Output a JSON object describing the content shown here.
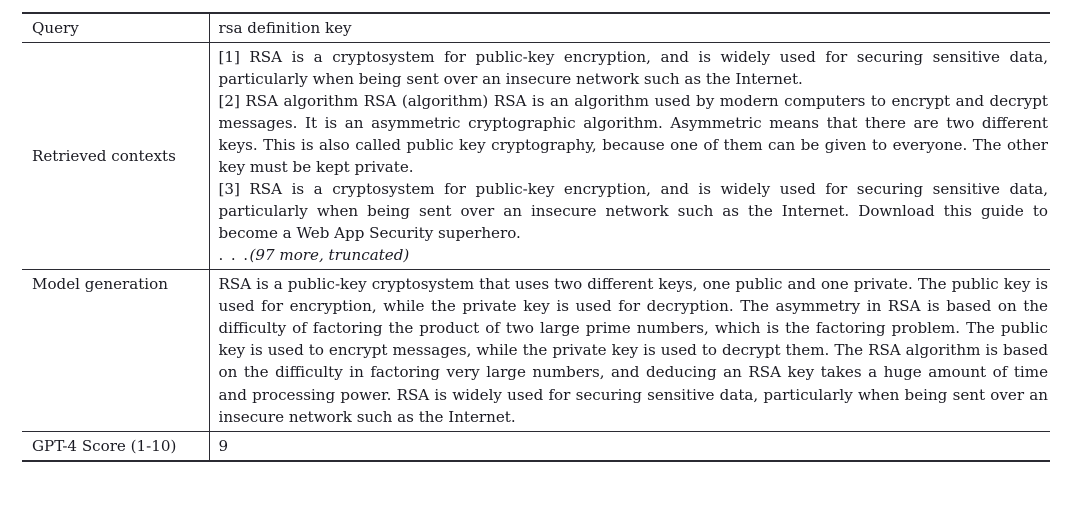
{
  "table": {
    "rows": [
      {
        "label": "Query",
        "type": "query",
        "value": "rsa definition key"
      },
      {
        "label": "Retrieved contexts",
        "type": "contexts",
        "passages": [
          "[1] RSA is a cryptosystem for public-key encryption, and is widely used for securing sensitive data, particularly when being sent over an insecure network such as the Internet.",
          "[2] RSA algorithm RSA (algorithm) RSA is an algorithm used by modern computers to encrypt and decrypt messages. It is an asymmetric cryptographic algorithm. Asymmetric means that there are two different keys. This is also called public key cryptography, because one of them can be given to everyone. The other key must be kept private.",
          "[3] RSA is a cryptosystem for public-key encryption, and is widely used for securing sensitive data, particularly when being sent over an insecure network such as the Internet. Download this guide to become a Web App Security superhero."
        ],
        "truncation_ellipsis": ". . .",
        "truncation_note": "(97 more, truncated)"
      },
      {
        "label": "Model generation",
        "type": "generation",
        "value": "RSA is a public-key cryptosystem that uses two different keys, one public and one private. The public key is used for encryption, while the private key is used for decryption. The asymmetry in RSA is based on the difficulty of factoring the product of two large prime numbers, which is the factoring problem. The public key is used to encrypt messages, while the private key is used to decrypt them. The RSA algorithm is based on the difficulty in factoring very large numbers, and deducing an RSA key takes a huge amount of time and processing power. RSA is widely used for securing sensitive data, particularly when being sent over an insecure network such as the Internet."
      },
      {
        "label": "GPT-4 Score (1-10)",
        "type": "score",
        "value": "9"
      }
    ]
  },
  "colors": {
    "rule": "#2b2b33",
    "text": "#1a1a22",
    "background": "#ffffff"
  }
}
